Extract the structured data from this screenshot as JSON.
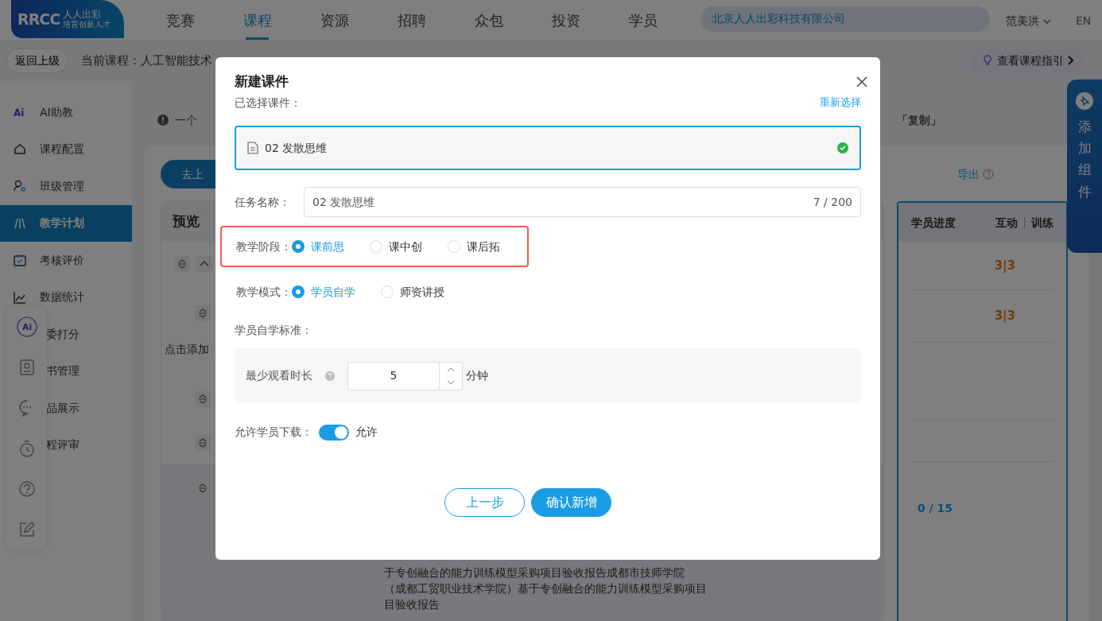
{
  "header": {
    "logo": {
      "mark": "RRCC",
      "name": "人人出彩",
      "slogan": "培育创新人才"
    },
    "nav": [
      {
        "label": "竞赛",
        "selected": false
      },
      {
        "label": "课程",
        "selected": true
      },
      {
        "label": "资源",
        "selected": false
      },
      {
        "label": "招聘",
        "selected": false
      },
      {
        "label": "众包",
        "selected": false
      },
      {
        "label": "投资",
        "selected": false
      },
      {
        "label": "学员",
        "selected": false
      }
    ],
    "org": "北京人人出彩科技有限公司",
    "user": "范美洪",
    "lang": "EN"
  },
  "subbar": {
    "back": "返回上级",
    "course": "当前课程：人工智能技术",
    "guide": "查看课程指引"
  },
  "sidebar": {
    "items": [
      {
        "label": "AI助教",
        "selected": false,
        "mark": "Ai"
      },
      {
        "label": "课程配置",
        "selected": false
      },
      {
        "label": "班级管理",
        "selected": false
      },
      {
        "label": "教学计划",
        "selected": true
      },
      {
        "label": "考核评价",
        "selected": false
      },
      {
        "label": "数据统计",
        "selected": false
      },
      {
        "label": "委打分",
        "selected": false
      },
      {
        "label": "书管理",
        "selected": false
      },
      {
        "label": "品展示",
        "selected": false
      },
      {
        "label": "程评审",
        "selected": false
      }
    ]
  },
  "notice": {
    "text": "一个",
    "tail": "「复制」"
  },
  "plan": {
    "start_button": "去上",
    "export": "导出",
    "preview_title": "预览",
    "add_hint": "点击添加",
    "description": [
      "于专创融合的能力训练模型采购项目验收报告成都市技师学院",
      "（成都工贸职业技术学院）基于专创融合的能力训练模型采购项目",
      "目验收报告"
    ]
  },
  "progress": {
    "columns": [
      "学员进度",
      "互动",
      "训练"
    ],
    "rows": [
      {
        "value": "3|3"
      },
      {
        "value": "3|3"
      }
    ],
    "total": "0 / 15"
  },
  "side_tab": {
    "label": "添加组件"
  },
  "toolbar": {
    "ai_badge": "Ai"
  },
  "dialog": {
    "title": "新建课件",
    "selected_label": "已选择课件：",
    "reselect": "重新选择",
    "file": {
      "name": "02 发散思维",
      "verified": true
    },
    "task_name": {
      "label": "任务名称：",
      "value": "02 发散思维",
      "counter": "7 / 200"
    },
    "stage": {
      "label": "教学阶段：",
      "highlighted": true,
      "options": [
        {
          "label": "课前思",
          "selected": true
        },
        {
          "label": "课中创",
          "selected": false
        },
        {
          "label": "课后拓",
          "selected": false
        }
      ]
    },
    "mode": {
      "label": "教学模式：",
      "options": [
        {
          "label": "学员自学",
          "selected": true
        },
        {
          "label": "师资讲授",
          "selected": false
        }
      ]
    },
    "standard": {
      "title": "学员自学标准：",
      "label": "最少观看时长",
      "value": "5",
      "unit": "分钟"
    },
    "download": {
      "label": "允许学员下载：",
      "on": true,
      "text": "允许"
    },
    "back_button": "上一步",
    "confirm_button": "确认新增"
  }
}
